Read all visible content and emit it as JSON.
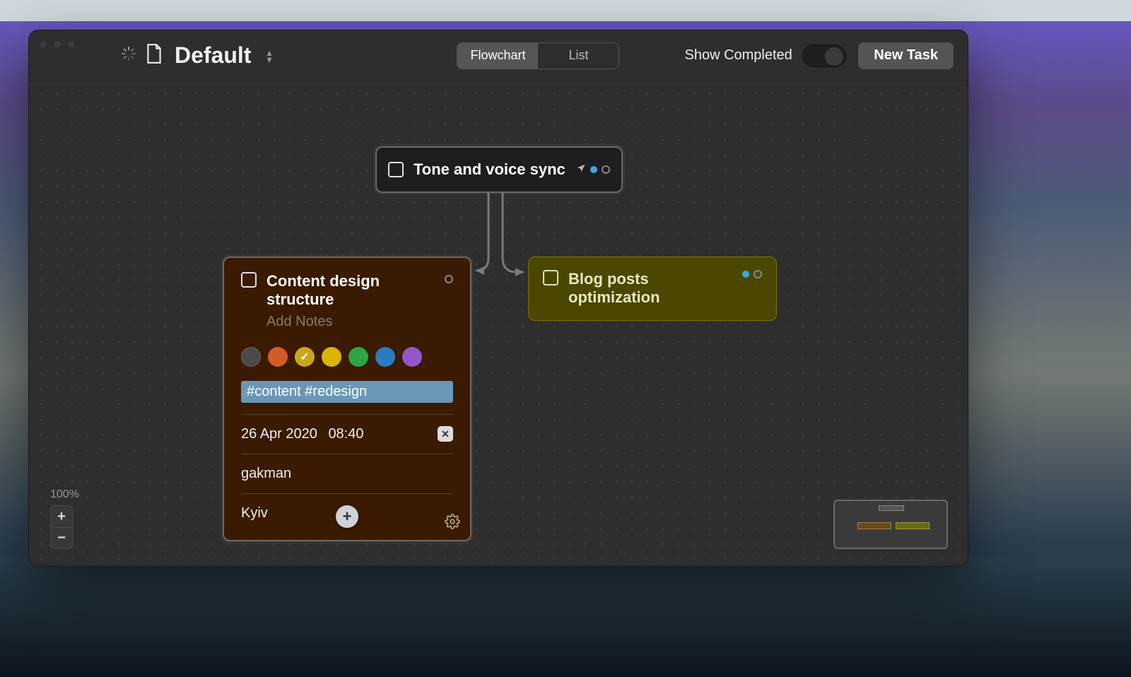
{
  "toolbar": {
    "title": "Default",
    "view_segments": {
      "flowchart": "Flowchart",
      "list": "List",
      "active": "flowchart"
    },
    "show_completed_label": "Show Completed",
    "show_completed_on": false,
    "new_task_label": "New Task"
  },
  "zoom": {
    "level_label": "100%",
    "in": "+",
    "out": "−"
  },
  "nodes": {
    "parent": {
      "title": "Tone and voice sync"
    },
    "content": {
      "title": "Content design structure",
      "notes_placeholder": "Add Notes",
      "colors": [
        "gray",
        "orange",
        "mustard",
        "yellow",
        "green",
        "blue",
        "purple"
      ],
      "selected_color": "mustard",
      "tags": "#content #redesign",
      "date": "26 Apr 2020",
      "time": "08:40",
      "assignee": "gakman",
      "location": "Kyiv"
    },
    "blog": {
      "title": "Blog posts optimization"
    }
  }
}
